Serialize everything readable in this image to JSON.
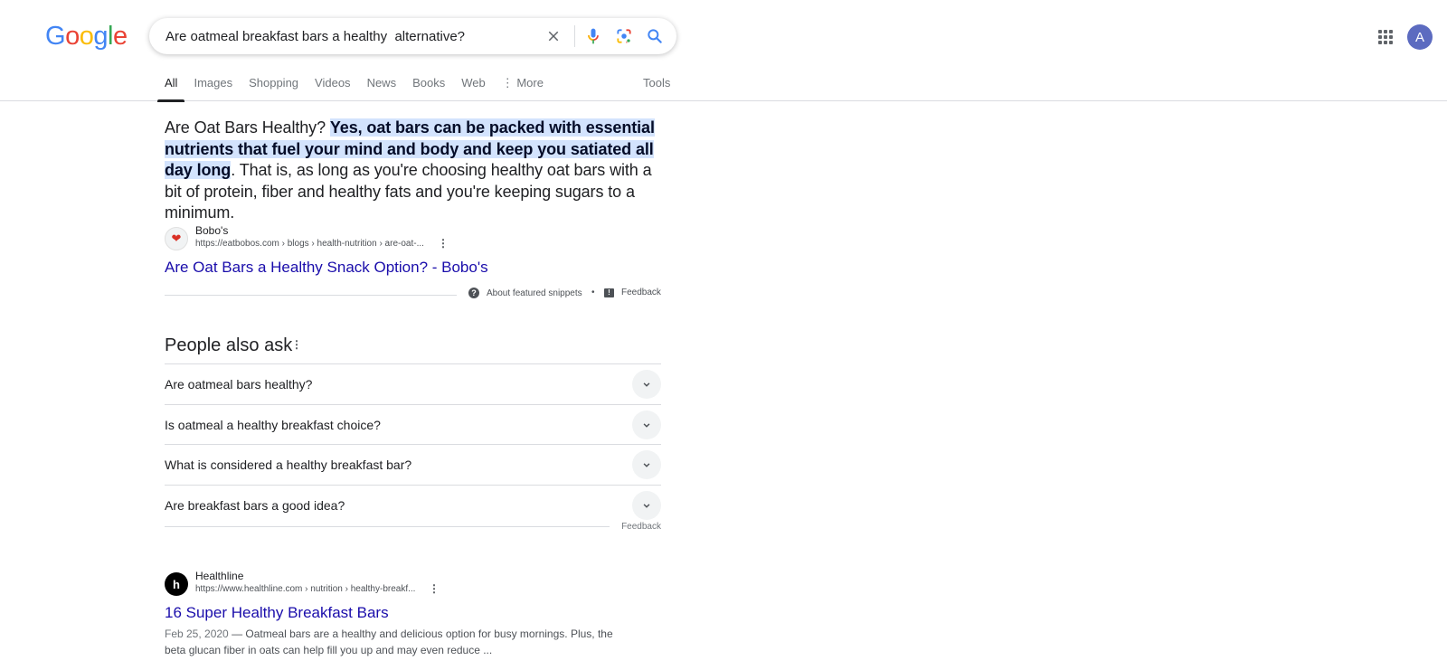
{
  "logo": {
    "letters": [
      {
        "ch": "G",
        "color": "#4285f4"
      },
      {
        "ch": "o",
        "color": "#ea4335"
      },
      {
        "ch": "o",
        "color": "#fbbc05"
      },
      {
        "ch": "g",
        "color": "#4285f4"
      },
      {
        "ch": "l",
        "color": "#34a853"
      },
      {
        "ch": "e",
        "color": "#ea4335"
      }
    ]
  },
  "search": {
    "query": "Are oatmeal breakfast bars a healthy  alternative?",
    "icons": [
      "close-icon",
      "microphone-icon",
      "google-lens-icon",
      "search-icon"
    ]
  },
  "header": {
    "apps_icon": "apps-grid-icon",
    "avatar_letter": "A"
  },
  "tabs": {
    "items": [
      {
        "label": "All",
        "active": true
      },
      {
        "label": "Images"
      },
      {
        "label": "Shopping"
      },
      {
        "label": "Videos"
      },
      {
        "label": "News"
      },
      {
        "label": "Books"
      },
      {
        "label": "Web"
      },
      {
        "label": "⋮ More"
      }
    ],
    "tools_label": "Tools"
  },
  "featured_snippet": {
    "lead": "Are Oat Bars Healthy? ",
    "highlight": "Yes, oat bars can be packed with essential nutrients that fuel your mind and body and keep you satiated all day long",
    "rest": ". That is, as long as you're choosing healthy oat bars with a bit of protein, fiber and healthy fats and you're keeping sugars to a minimum.",
    "source_name": "Bobo's",
    "source_url": "https://eatbobos.com › blogs › health-nutrition › are-oat-...",
    "title": "Are Oat Bars a Healthy Snack Option? - Bobo's",
    "about_label": "About featured snippets",
    "separator": "•",
    "feedback_label": "Feedback"
  },
  "people_also_ask": {
    "title": "People also ask",
    "questions": [
      "Are oatmeal bars healthy?",
      "Is oatmeal a healthy breakfast choice?",
      "What is considered a healthy breakfast bar?",
      "Are breakfast bars a good idea?"
    ],
    "feedback_label": "Feedback"
  },
  "results": [
    {
      "source_name": "Healthline",
      "source_url": "https://www.healthline.com › nutrition › healthy-breakf...",
      "title": "16 Super Healthy Breakfast Bars",
      "date": "Feb 25, 2020",
      "dash": " — ",
      "description": "Oatmeal bars are a healthy and delicious option for busy mornings. Plus, the beta glucan fiber in oats can help fill you up and may even reduce ..."
    }
  ],
  "colors": {
    "link": "#1a0dab",
    "highlight_bg": "#d3e3fd",
    "avatar_bg": "#5c6bc0"
  }
}
